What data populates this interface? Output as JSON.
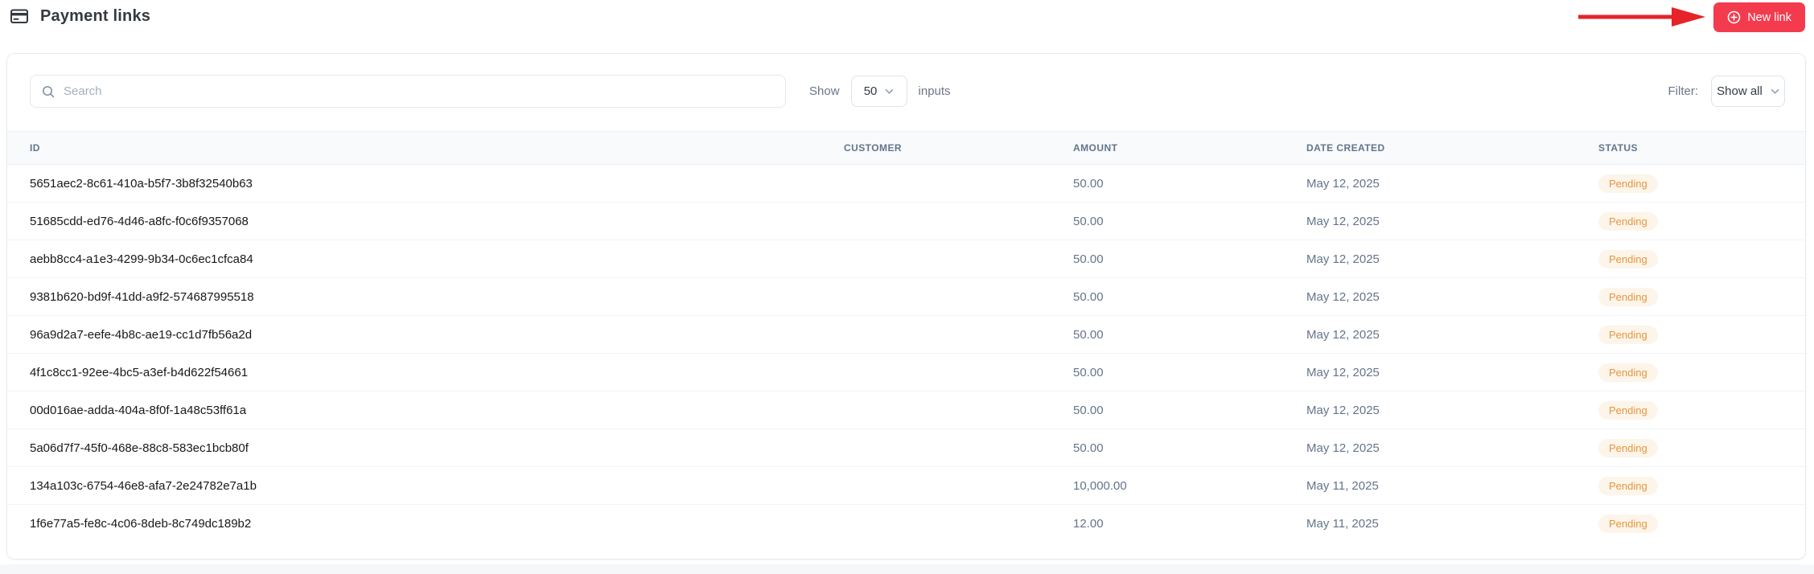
{
  "header": {
    "title": "Payment links",
    "new_link_button": "New link"
  },
  "toolbar": {
    "search_placeholder": "Search",
    "show_label": "Show",
    "page_size_value": "50",
    "inputs_label": "inputs",
    "filter_label": "Filter:",
    "filter_value": "Show all"
  },
  "table": {
    "columns": {
      "id": "ID",
      "customer": "CUSTOMER",
      "amount": "AMOUNT",
      "date_created": "DATE CREATED",
      "status": "STATUS"
    },
    "rows": [
      {
        "id": "5651aec2-8c61-410a-b5f7-3b8f32540b63",
        "customer": "",
        "amount": "50.00",
        "date_created": "May 12, 2025",
        "status": "Pending"
      },
      {
        "id": "51685cdd-ed76-4d46-a8fc-f0c6f9357068",
        "customer": "",
        "amount": "50.00",
        "date_created": "May 12, 2025",
        "status": "Pending"
      },
      {
        "id": "aebb8cc4-a1e3-4299-9b34-0c6ec1cfca84",
        "customer": "",
        "amount": "50.00",
        "date_created": "May 12, 2025",
        "status": "Pending"
      },
      {
        "id": "9381b620-bd9f-41dd-a9f2-574687995518",
        "customer": "",
        "amount": "50.00",
        "date_created": "May 12, 2025",
        "status": "Pending"
      },
      {
        "id": "96a9d2a7-eefe-4b8c-ae19-cc1d7fb56a2d",
        "customer": "",
        "amount": "50.00",
        "date_created": "May 12, 2025",
        "status": "Pending"
      },
      {
        "id": "4f1c8cc1-92ee-4bc5-a3ef-b4d622f54661",
        "customer": "",
        "amount": "50.00",
        "date_created": "May 12, 2025",
        "status": "Pending"
      },
      {
        "id": "00d016ae-adda-404a-8f0f-1a48c53ff61a",
        "customer": "",
        "amount": "50.00",
        "date_created": "May 12, 2025",
        "status": "Pending"
      },
      {
        "id": "5a06d7f7-45f0-468e-88c8-583ec1bcb80f",
        "customer": "",
        "amount": "50.00",
        "date_created": "May 12, 2025",
        "status": "Pending"
      },
      {
        "id": "134a103c-6754-46e8-afa7-2e24782e7a1b",
        "customer": "",
        "amount": "10,000.00",
        "date_created": "May 11, 2025",
        "status": "Pending"
      },
      {
        "id": "1f6e77a5-fe8c-4c06-8deb-8c749dc189b2",
        "customer": "",
        "amount": "12.00",
        "date_created": "May 11, 2025",
        "status": "Pending"
      }
    ]
  },
  "icons": {
    "header": "credit-card-icon",
    "button": "plus-circle-icon",
    "search": "search-icon",
    "selects": "chevron-down-icon",
    "annotation": "red-arrow-annotation"
  },
  "colors": {
    "accent_red": "#f43b4e",
    "arrow_red": "#e62328",
    "status_pending_text": "#e5953f",
    "status_pending_bg": "#fdf5e9",
    "muted_text": "#64748b",
    "header_band_bg": "#f8fafc"
  }
}
